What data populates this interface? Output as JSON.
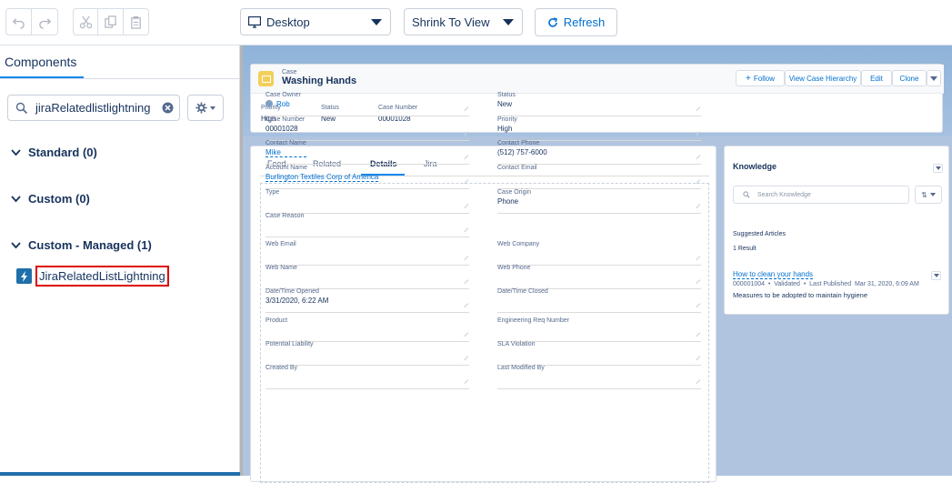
{
  "toolbar": {
    "device_select": "Desktop",
    "zoom_select": "Shrink To View",
    "refresh_label": "Refresh"
  },
  "left_panel": {
    "tab_label": "Components",
    "search_value": "jiraRelatedlistlightning",
    "sections": [
      {
        "label": "Standard (0)"
      },
      {
        "label": "Custom (0)"
      },
      {
        "label": "Custom - Managed (1)"
      }
    ],
    "component_item": "JiraRelatedListLightning"
  },
  "record": {
    "object_label": "Case",
    "title": "Washing Hands",
    "actions": [
      "Follow",
      "View Case Hierarchy",
      "Edit",
      "Clone"
    ],
    "highlights": [
      {
        "label": "Priority",
        "value": "High"
      },
      {
        "label": "Status",
        "value": "New"
      },
      {
        "label": "Case Number",
        "value": "00001028"
      }
    ]
  },
  "detail_tabs": [
    "Feed",
    "Related",
    "Details",
    "Jira"
  ],
  "active_tab": "Details",
  "fields_left": [
    {
      "label": "Case Owner",
      "value": "Rob",
      "link": true
    },
    {
      "label": "Case Number",
      "value": "00001028"
    },
    {
      "label": "Contact Name",
      "value": "Mike",
      "link": true
    },
    {
      "label": "Account Name",
      "value": "Burlington Textiles Corp of America",
      "link": true
    },
    {
      "label": "Type",
      "value": ""
    },
    {
      "label": "Case Reason",
      "value": ""
    },
    {
      "label": "Web Email",
      "value": ""
    },
    {
      "label": "Web Name",
      "value": ""
    },
    {
      "label": "Date/Time Opened",
      "value": "3/31/2020, 6:22 AM"
    },
    {
      "label": "Product",
      "value": ""
    },
    {
      "label": "Potential Liability",
      "value": ""
    },
    {
      "label": "Created By",
      "value": ""
    }
  ],
  "fields_right": [
    {
      "label": "Status",
      "value": "New"
    },
    {
      "label": "Priority",
      "value": "High"
    },
    {
      "label": "Contact Phone",
      "value": "(512) 757-6000"
    },
    {
      "label": "Contact Email",
      "value": ""
    },
    {
      "label": "Case Origin",
      "value": "Phone"
    },
    {
      "label": "Web Company",
      "value": ""
    },
    {
      "label": "Web Phone",
      "value": ""
    },
    {
      "label": "Date/Time Closed",
      "value": ""
    },
    {
      "label": "Engineering Req Number",
      "value": ""
    },
    {
      "label": "SLA Violation",
      "value": ""
    },
    {
      "label": "Last Modified By",
      "value": ""
    }
  ],
  "knowledge": {
    "title": "Knowledge",
    "search_placeholder": "Search Knowledge",
    "suggested_label": "Suggested Articles",
    "result_count": "1 Result",
    "article_title": "How to clean your hands",
    "article_meta": "000001004  •  Validated  •  Last Published  Mar 31, 2020, 6:09 AM",
    "article_summary": "Measures to be adopted to maintain hygiene"
  },
  "colors": {
    "brand_blue": "#0070d2",
    "highlight_red": "#d00000",
    "case_icon": "#f2cf5b"
  }
}
